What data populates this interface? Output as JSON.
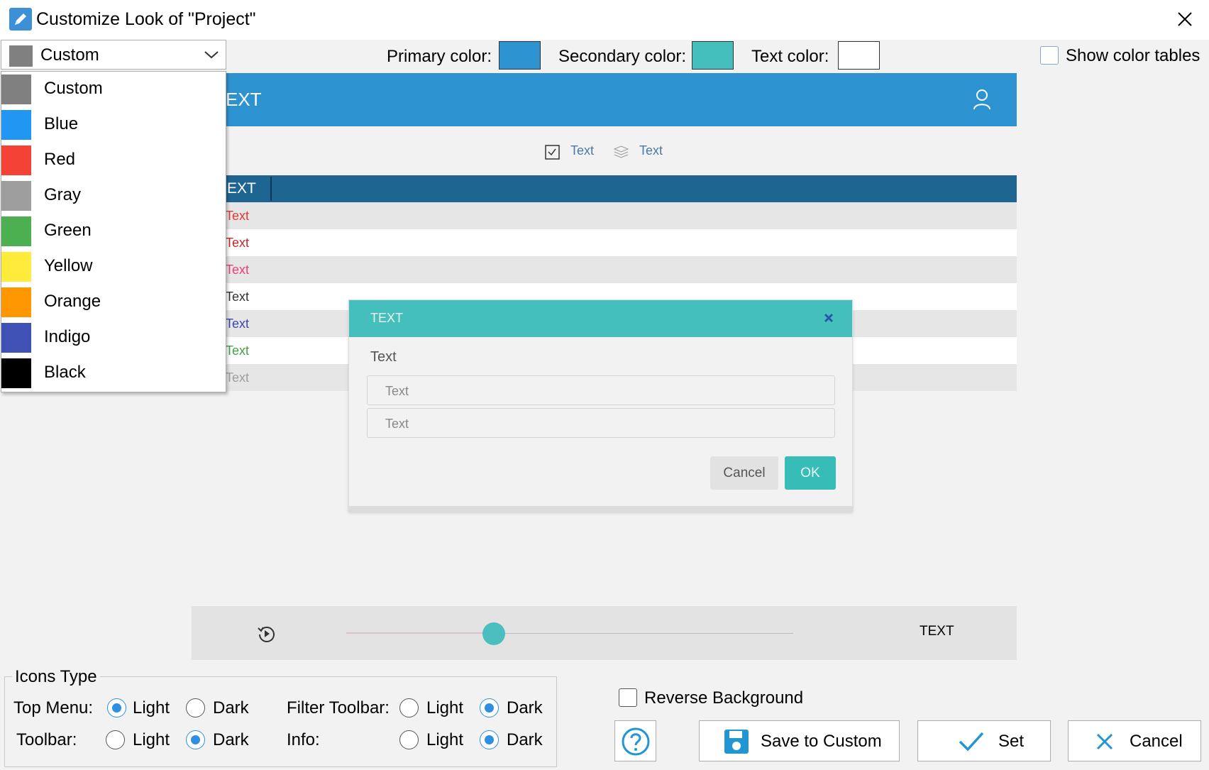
{
  "window": {
    "title": "Customize Look of \"Project\"",
    "app_icon": "pencil-icon",
    "close_icon": "close-icon"
  },
  "theme": {
    "selected": "Custom",
    "selected_color": "#808080",
    "options": [
      {
        "label": "Custom",
        "color": "#808080"
      },
      {
        "label": "Blue",
        "color": "#2196f3"
      },
      {
        "label": "Red",
        "color": "#f44336"
      },
      {
        "label": "Gray",
        "color": "#9e9e9e"
      },
      {
        "label": "Green",
        "color": "#4caf50"
      },
      {
        "label": "Yellow",
        "color": "#ffeb3b"
      },
      {
        "label": "Orange",
        "color": "#ff9800"
      },
      {
        "label": "Indigo",
        "color": "#3f51b5"
      },
      {
        "label": "Black",
        "color": "#000000"
      }
    ]
  },
  "colors": {
    "primary_label": "Primary color:",
    "primary_value": "#2d93d0",
    "secondary_label": "Secondary color:",
    "secondary_value": "#44bfbd",
    "text_label": "Text color:",
    "text_value": "#ffffff"
  },
  "show_color_tables": {
    "label": "Show color tables",
    "checked": false
  },
  "preview": {
    "header_text": "EXT",
    "toolbar": [
      {
        "icon": "checkbox-icon",
        "label": "Text"
      },
      {
        "icon": "layers-icon",
        "label": "Text"
      }
    ],
    "table_header": "EXT",
    "rows": [
      {
        "text": "Text",
        "color": "#e53935"
      },
      {
        "text": "Text",
        "color": "#c62828"
      },
      {
        "text": "Text",
        "color": "#ec407a"
      },
      {
        "text": "Text",
        "color": "#333333"
      },
      {
        "text": "Text",
        "color": "#3949ab"
      },
      {
        "text": "Text",
        "color": "#43a047"
      },
      {
        "text": "Text",
        "color": "#9e9e9e"
      }
    ],
    "dialog": {
      "title": "TEXT",
      "label": "Text",
      "field1_placeholder": "Text",
      "field2_placeholder": "Text",
      "cancel_label": "Cancel",
      "ok_label": "OK"
    },
    "player": {
      "label": "TEXT",
      "progress": 0.33
    }
  },
  "icons_type": {
    "title": "Icons Type",
    "top_menu_label": "Top Menu:",
    "toolbar_label": "Toolbar:",
    "filter_toolbar_label": "Filter Toolbar:",
    "info_label": "Info:",
    "light": "Light",
    "dark": "Dark",
    "top_menu": "Light",
    "toolbar": "Dark",
    "filter_toolbar": "Dark",
    "info": "Dark"
  },
  "reverse_background": {
    "label": "Reverse Background",
    "checked": false
  },
  "buttons": {
    "help_icon": "help-icon",
    "save_label": "Save to Custom",
    "set_label": "Set",
    "cancel_label": "Cancel"
  }
}
